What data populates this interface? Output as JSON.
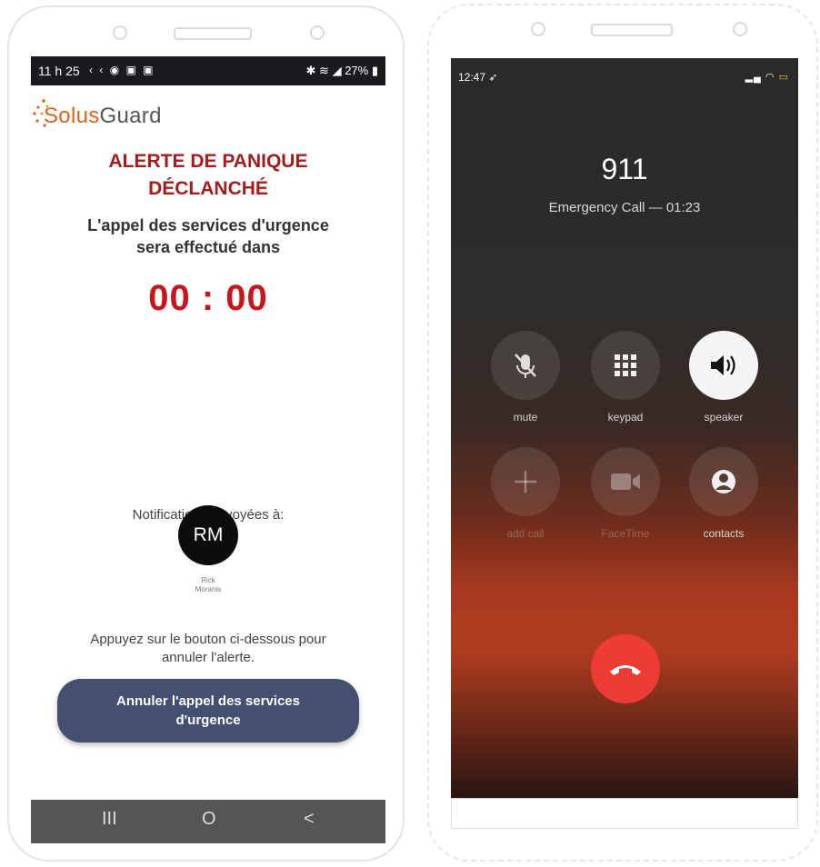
{
  "left_phone": {
    "status_bar": {
      "time": "11 h 25",
      "icons_left": "‹ ‹ ◉ ▣ ▣",
      "battery": "27%"
    },
    "brand": {
      "part1": "Solus",
      "part2": "Guard"
    },
    "alert_title_line1": "ALERTE DE PANIQUE",
    "alert_title_line2": "DÉCLANCHÉ",
    "subtitle_line1": "L'appel des services d'urgence",
    "subtitle_line2": "sera effectué dans",
    "countdown": "00 : 00",
    "notifications_label": "Notifications envoyées à:",
    "contact": {
      "initials": "RM",
      "first_name": "Rick",
      "last_name": "Moranis"
    },
    "instruction_line1": "Appuyez sur le bouton ci-dessous pour",
    "instruction_line2": "annuler l'alerte.",
    "cancel_button": "Annuler l'appel des services d'urgence",
    "nav": {
      "recents": "III",
      "home": "O",
      "back": "<"
    },
    "colors": {
      "accent_red": "#c8161c",
      "button": "#435070",
      "brand_orange": "#e0611b"
    }
  },
  "right_phone": {
    "status_bar": {
      "time": "12:47"
    },
    "call_number": "911",
    "call_status": "Emergency Call — 01:23",
    "buttons": [
      {
        "label": "mute",
        "icon": "mic-off-icon"
      },
      {
        "label": "keypad",
        "icon": "keypad-icon"
      },
      {
        "label": "speaker",
        "icon": "speaker-icon"
      },
      {
        "label": "add call",
        "icon": "plus-icon"
      },
      {
        "label": "FaceTime",
        "icon": "video-icon"
      },
      {
        "label": "contacts",
        "icon": "contacts-icon"
      }
    ],
    "end_call_icon": "hang-up-icon",
    "colors": {
      "end_call": "#ed3b36"
    }
  }
}
